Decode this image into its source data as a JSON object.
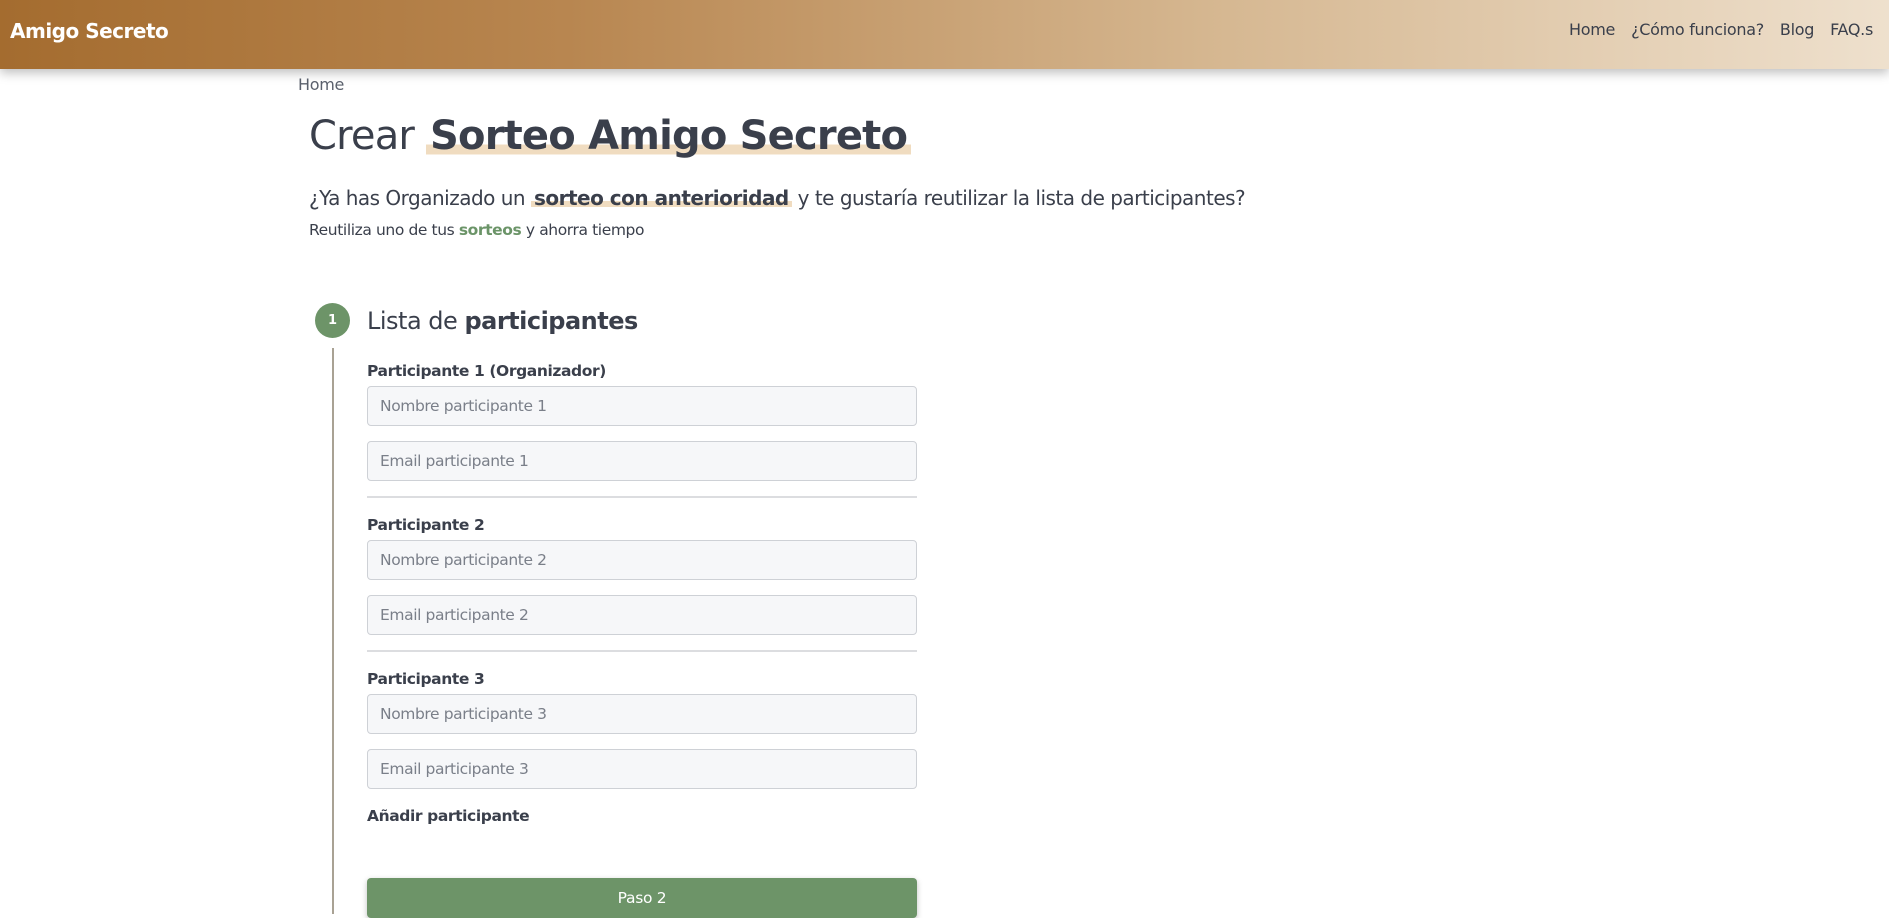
{
  "navbar": {
    "brand": "Amigo Secreto",
    "links": [
      "Home",
      "¿Cómo funciona?",
      "Blog",
      "FAQ.s"
    ]
  },
  "breadcrumb": "Home",
  "title": {
    "prefix": "Crear",
    "highlight": "Sorteo Amigo Secreto"
  },
  "intro": {
    "lead_before": "¿Ya has Organizado un",
    "lead_highlight": "sorteo con anterioridad",
    "lead_after": "y te gustaría reutilizar la lista de participantes?",
    "sub_before": "Reutiliza uno de tus",
    "sub_link": "sorteos",
    "sub_after": "y ahorra tiempo"
  },
  "step": {
    "number": "1",
    "title_prefix": "Lista de",
    "title_bold": "participantes"
  },
  "participants": [
    {
      "label": "Participante 1 (Organizador)",
      "name_placeholder": "Nombre participante 1",
      "email_placeholder": "Email participante 1"
    },
    {
      "label": "Participante 2",
      "name_placeholder": "Nombre participante 2",
      "email_placeholder": "Email participante 2"
    },
    {
      "label": "Participante 3",
      "name_placeholder": "Nombre participante 3",
      "email_placeholder": "Email participante 3"
    }
  ],
  "add_participant": "Añadir participante",
  "next_button": "Paso 2",
  "colors": {
    "accent_green": "#6d9468",
    "brand_brown": "#a46c2f",
    "highlight": "#f0dcc0"
  }
}
